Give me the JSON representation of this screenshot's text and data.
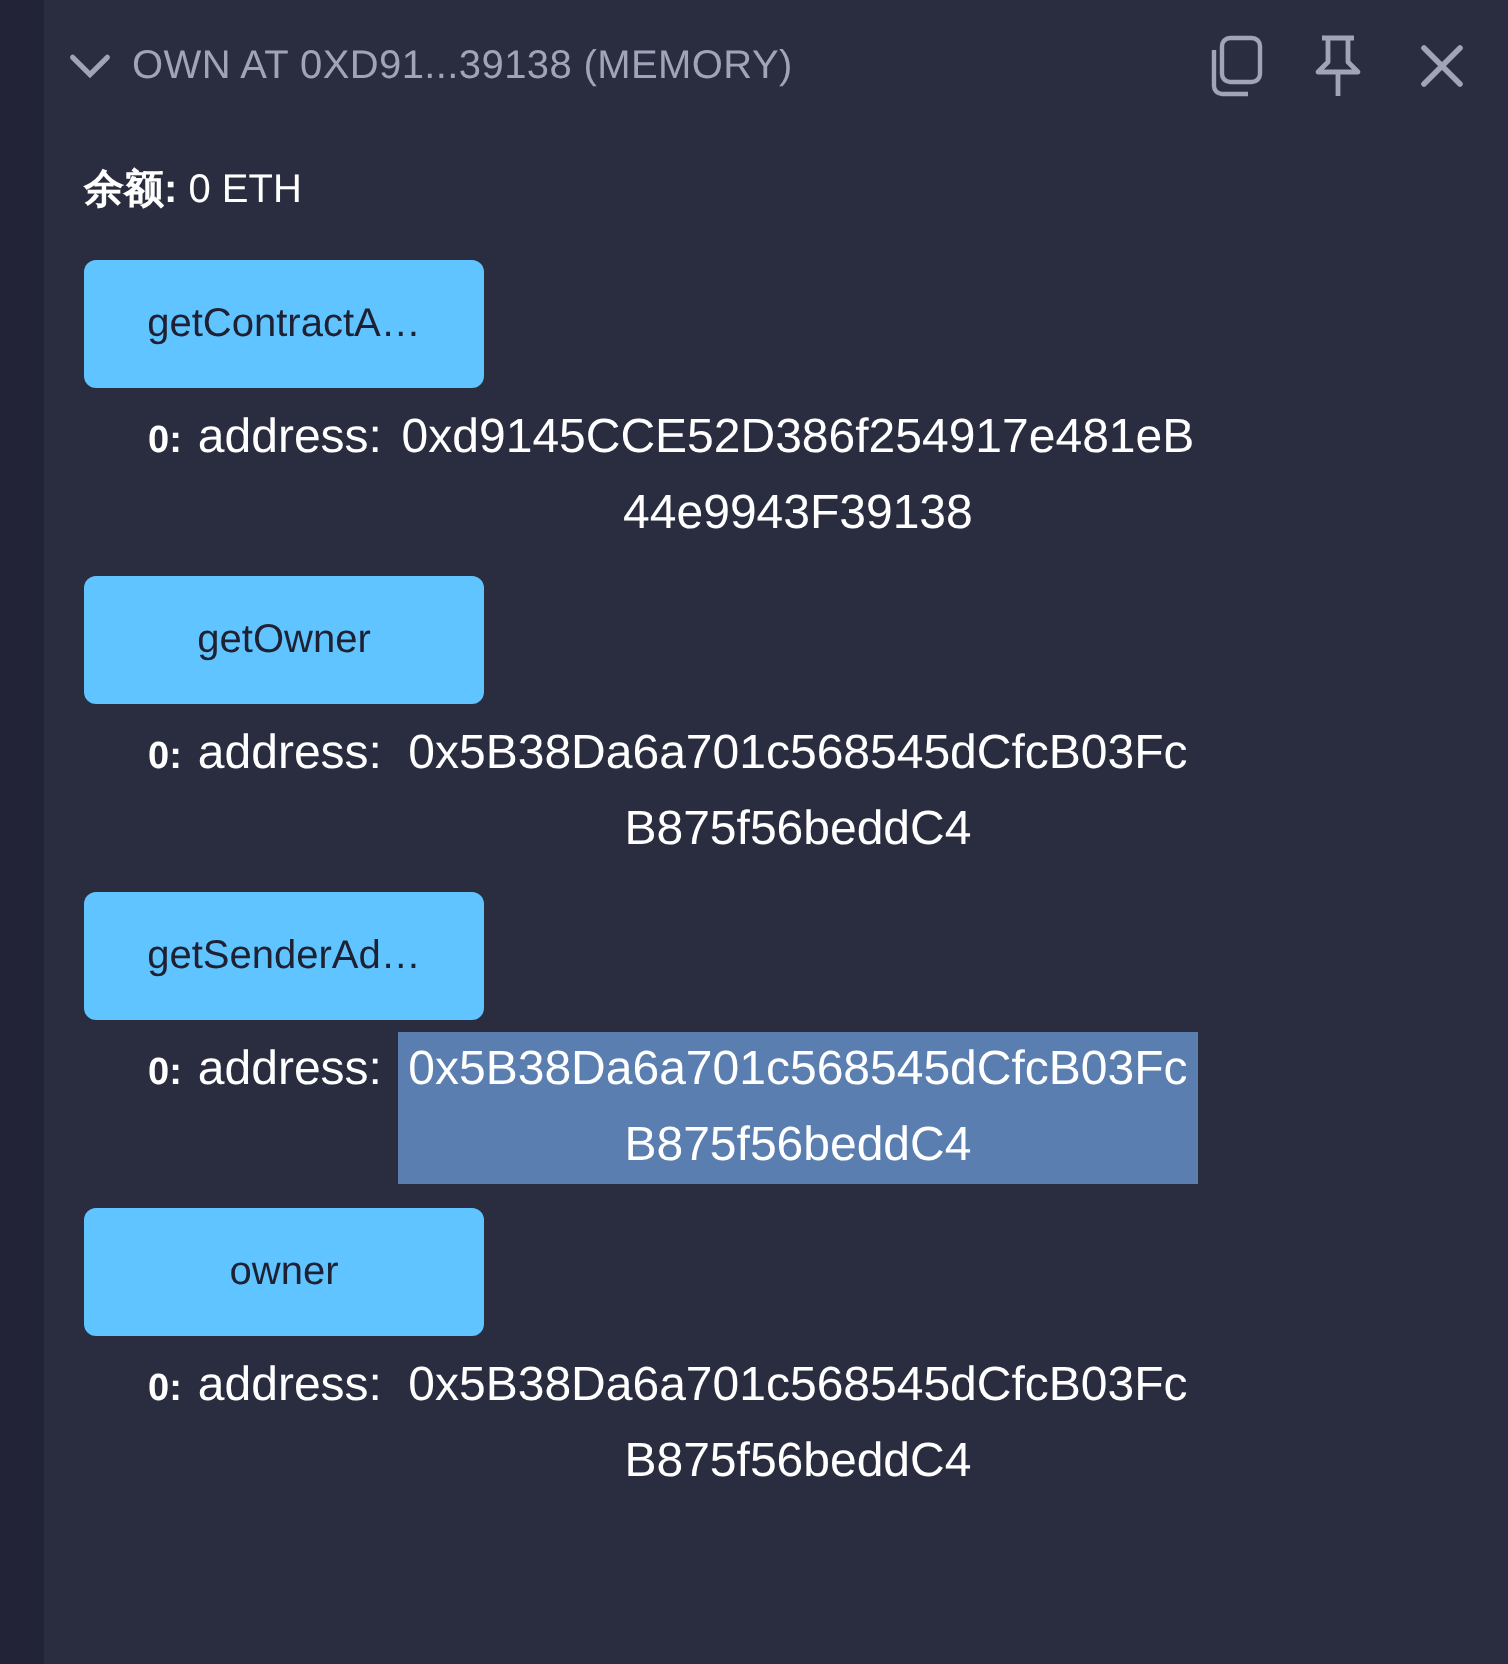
{
  "header": {
    "expanded": true,
    "title": "OWN AT 0XD91...39138 (MEMORY)"
  },
  "balance": "**余额:** 0 ETH",
  "functions": [
    {
      "label": "getContractA…",
      "outputs": [
        {
          "index": "0:",
          "type": "address:",
          "value": "0xd9145CCE52D386f254917e481eB44e9943F39138",
          "selected": false
        }
      ]
    },
    {
      "label": "getOwner",
      "outputs": [
        {
          "index": "0:",
          "type": "address:",
          "value": "0x5B38Da6a701c568545dCfcB03FcB875f56beddC4",
          "selected": false
        }
      ]
    },
    {
      "label": "getSenderAd…",
      "outputs": [
        {
          "index": "0:",
          "type": "address:",
          "value": "0x5B38Da6a701c568545dCfcB03FcB875f56beddC4",
          "selected": true
        }
      ]
    },
    {
      "label": "owner",
      "outputs": [
        {
          "index": "0:",
          "type": "address:",
          "value": "0x5B38Da6a701c568545dCfcB03FcB875f56beddC4",
          "selected": false
        }
      ]
    }
  ]
}
